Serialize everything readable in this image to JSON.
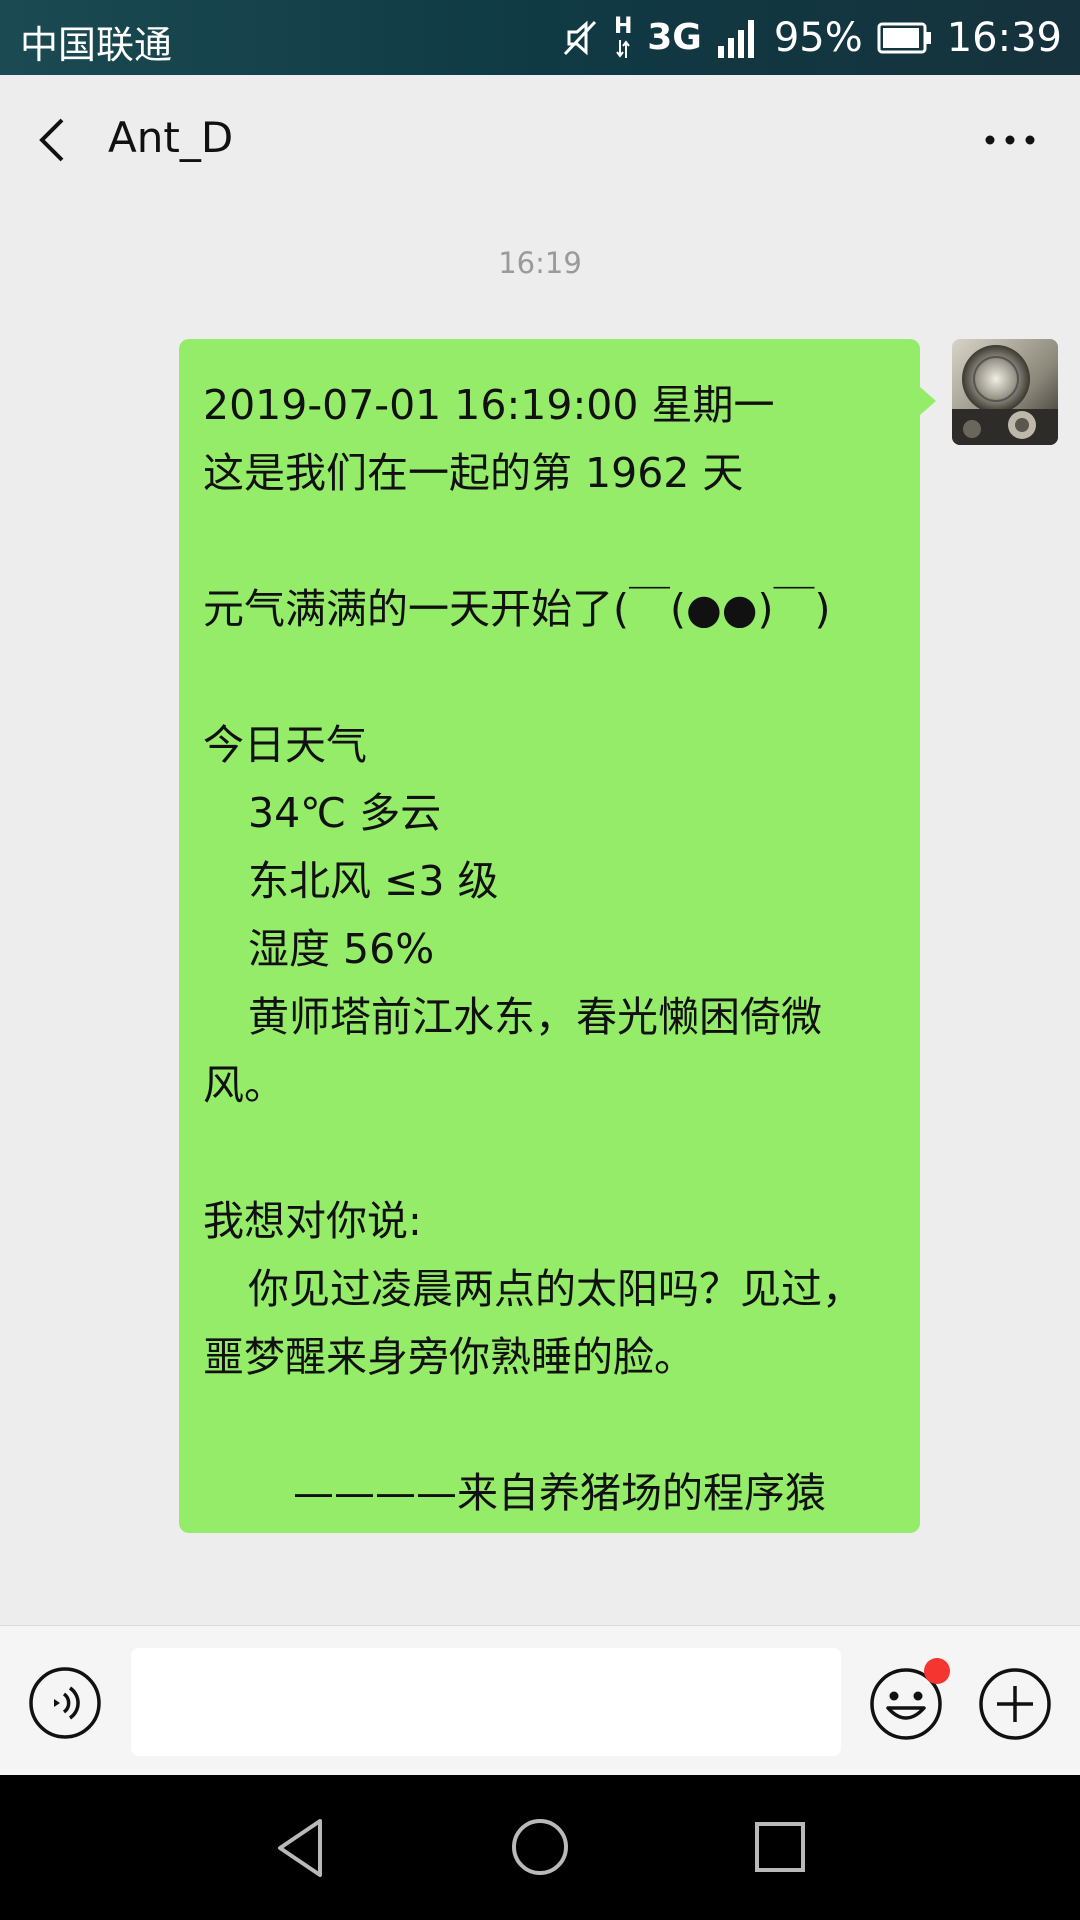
{
  "status_bar": {
    "carrier": "中国联通",
    "h_mark": "H",
    "network": "3G",
    "battery_percent": "95%",
    "time": "16:39",
    "battery_level": 0.95,
    "icons": [
      "mute-icon",
      "signal-icon",
      "battery-icon"
    ]
  },
  "header": {
    "title": "Ant_D",
    "back_icon": "chevron-left-icon",
    "more_icon": "more-dots-icon"
  },
  "chat": {
    "timestamp": "16:19",
    "message": {
      "lines": [
        "2019-07-01 16:19:00 星期一",
        "这是我们在一起的第 1962 天",
        "",
        "元气满满的一天开始了(￣(●●)￣)",
        "",
        "今日天气",
        "34℃ 多云",
        "东北风 ≤3 级",
        "湿度 56%",
        "黄师塔前江水东，春光懒困倚微",
        "风。",
        "",
        "我想对你说:",
        "你见过凌晨两点的太阳吗？见过，",
        "噩梦醒来身旁你熟睡的脸。",
        "",
        "————来自养猪场的程序猿"
      ],
      "bubble_color": "#95ec69"
    }
  },
  "input_bar": {
    "placeholder": "",
    "voice_icon": "voice-icon",
    "emoji_icon": "emoji-icon",
    "plus_icon": "plus-icon",
    "notification_dot_color": "#f43530"
  },
  "nav_bar": {
    "icons": [
      "nav-back-icon",
      "nav-home-icon",
      "nav-recent-icon"
    ]
  },
  "colors": {
    "background": "#ededed",
    "bubble": "#95ec69",
    "status_bar": "#0f3a44"
  }
}
